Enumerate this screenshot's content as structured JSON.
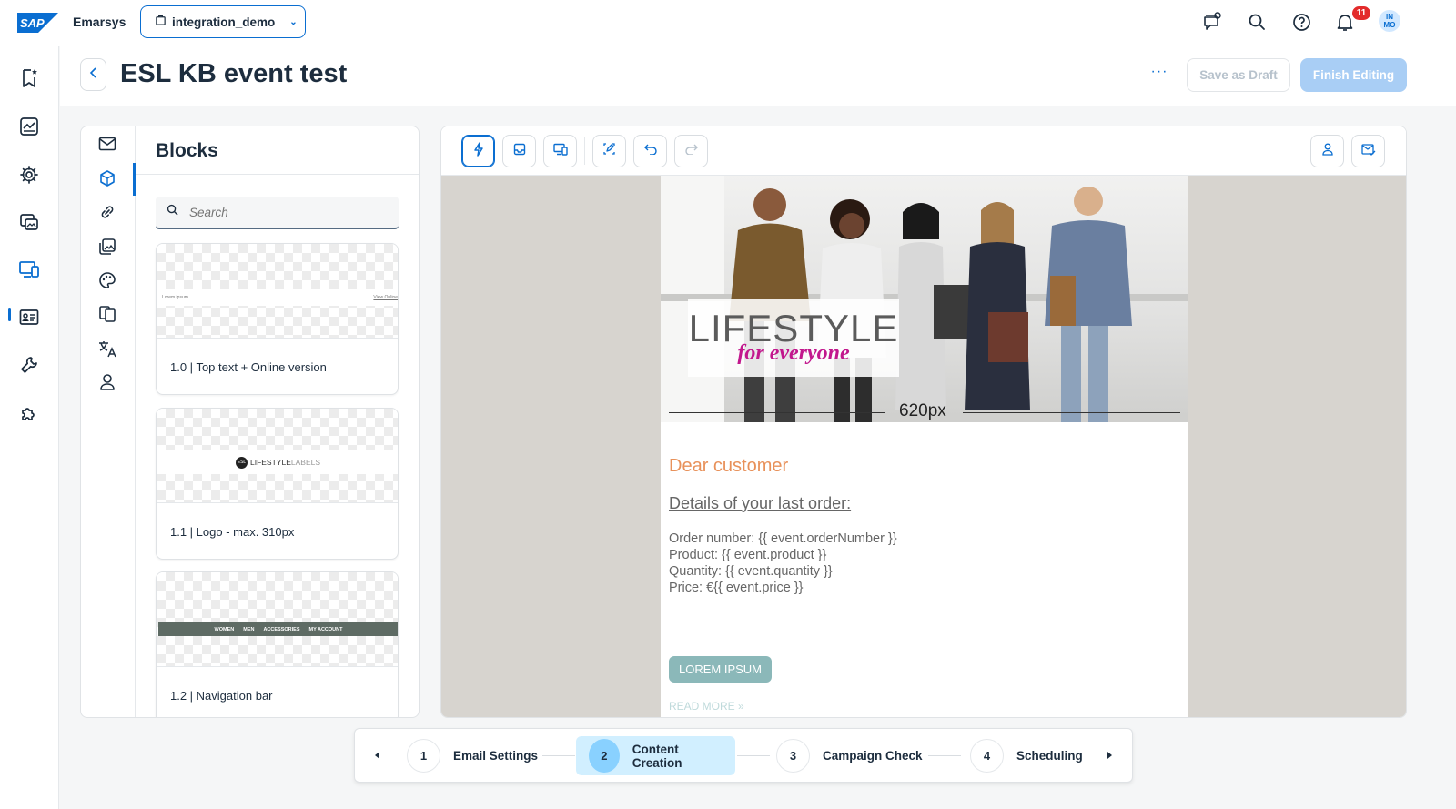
{
  "shell": {
    "brand": "SAP",
    "product": "Emarsys",
    "account": "integration_demo",
    "notification_count": "11",
    "avatar_initials_top": "IN",
    "avatar_initials_bottom": "MO"
  },
  "page": {
    "title": "ESL KB event test",
    "more": "···",
    "save_draft": "Save as Draft",
    "finish": "Finish Editing"
  },
  "blocks": {
    "title": "Blocks",
    "search_placeholder": "Search",
    "cards": [
      {
        "label": "1.0 | Top text + Online version",
        "preview_left": "Lorem ipsum",
        "preview_right": "View Online"
      },
      {
        "label": "1.1 | Logo - max. 310px",
        "preview_logo": "LIFESTYLE",
        "preview_logo_light": "LABELS",
        "preview_mark": "ESL"
      },
      {
        "label": "1.2 | Navigation bar",
        "preview_nav": [
          "WOMEN",
          "MEN",
          "ACCESSORIES",
          "MY ACCOUNT"
        ]
      }
    ]
  },
  "email": {
    "hero_title": "LIFESTYLE",
    "hero_script": "for everyone",
    "width_label": "620px",
    "greeting": "Dear customer",
    "subheading": "Details of your last order:",
    "lines": [
      "Order number: {{ event.orderNumber }}",
      "Product: {{ event.product }}",
      "Quantity: {{ event.quantity }}",
      "Price: €{{ event.price }}"
    ],
    "cta": "LOREM IPSUM",
    "read_more": "READ MORE »"
  },
  "stepper": {
    "steps": [
      {
        "num": "1",
        "label": "Email Settings"
      },
      {
        "num": "2",
        "label": "Content Creation"
      },
      {
        "num": "3",
        "label": "Campaign Check"
      },
      {
        "num": "4",
        "label": "Scheduling"
      }
    ],
    "current_step": "2"
  },
  "colors": {
    "accent": "#0a6ed1",
    "canvas_bg": "#d7d4cf",
    "greeting": "#e8915a",
    "cta": "#8bb8b9",
    "hero_script": "#c2188d",
    "current_step": "#d1efff"
  },
  "icons": {
    "shell": [
      "feedback-icon",
      "search-icon",
      "help-icon",
      "bell-icon"
    ],
    "leftnav": [
      "bookmark-star-icon",
      "analytics-icon",
      "settings-icon",
      "content-icon",
      "devices-icon",
      "contacts-icon",
      "tools-icon",
      "addons-icon"
    ],
    "rail": [
      "mail-icon",
      "cube-icon",
      "link-icon",
      "image-icon",
      "palette-icon",
      "copy-icon",
      "translate-icon",
      "person-icon"
    ],
    "toolbar": [
      "lightning-icon",
      "inbox-icon",
      "devices-icon",
      "edit-icon",
      "undo-icon",
      "redo-icon",
      "person-icon",
      "mail-check-icon"
    ]
  }
}
